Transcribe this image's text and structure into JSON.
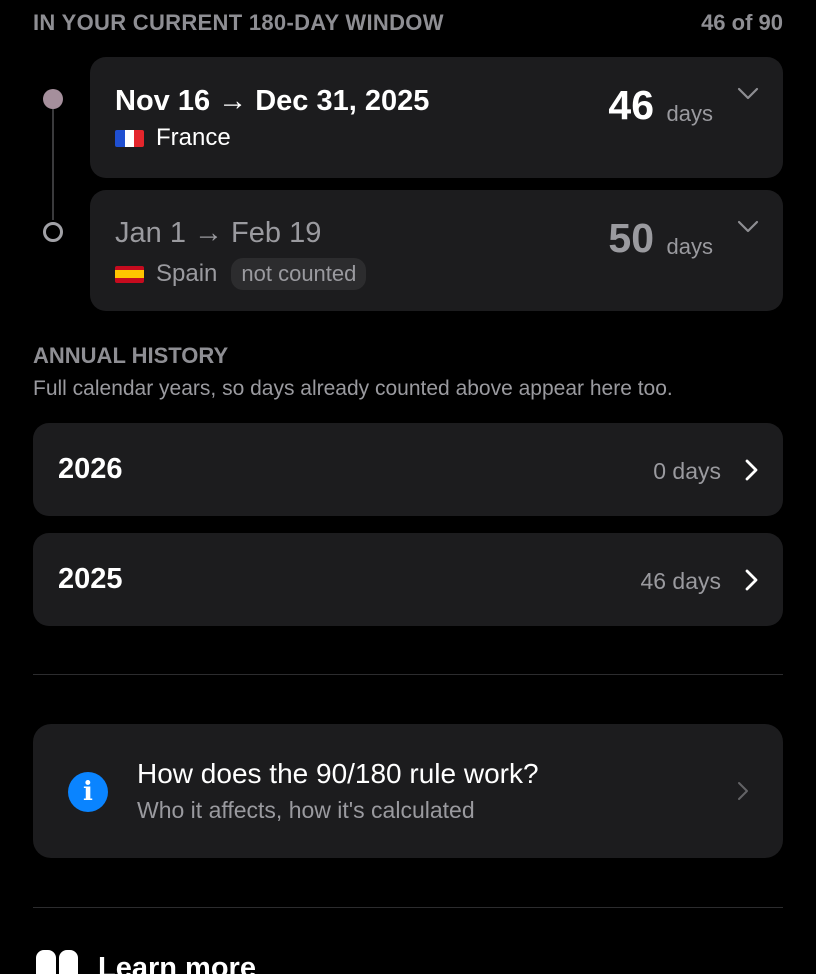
{
  "window_section": {
    "title": "IN YOUR CURRENT 180-DAY WINDOW",
    "count": "46 of 90"
  },
  "trips": [
    {
      "dates": "Nov 16 → Dec 31, 2025",
      "country": "France",
      "flag": "france-flag",
      "days": "46",
      "unit": "days",
      "counted": true
    },
    {
      "dates": "Jan 1 → Feb 19",
      "country": "Spain",
      "flag": "spain-flag",
      "days": "50",
      "unit": "days",
      "badge": "not counted",
      "counted": false
    }
  ],
  "annual_history": {
    "title": "ANNUAL HISTORY",
    "subtitle": "Full calendar years, so days already counted above appear here too.",
    "rows": [
      {
        "year": "2026",
        "days": "0 days"
      },
      {
        "year": "2025",
        "days": "46 days"
      }
    ]
  },
  "info_card": {
    "title": "How does the 90/180 rule work?",
    "subtitle": "Who it affects, how it's calculated",
    "icon": "info-icon"
  },
  "learn_more": {
    "label": "Learn more",
    "icon": "book-icon"
  },
  "colors": {
    "background": "#000000",
    "card": "#1c1c1e",
    "secondary_text": "#8e8e93",
    "accent_blue": "#0a84ff",
    "timeline_dot": "#a58f9c"
  }
}
